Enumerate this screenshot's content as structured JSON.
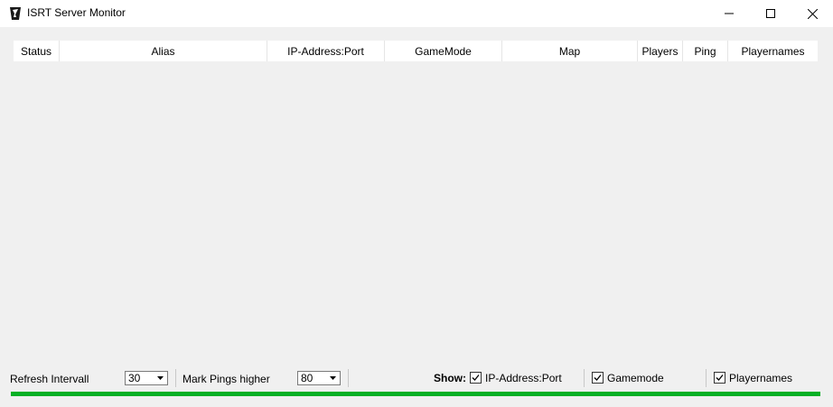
{
  "window": {
    "title": "ISRT Server Monitor",
    "minimize_label": "",
    "maximize_label": "",
    "close_label": ""
  },
  "table": {
    "columns": [
      "Status",
      "Alias",
      "IP-Address:Port",
      "GameMode",
      "Map",
      "Players",
      "Ping",
      "Playernames"
    ],
    "rows": []
  },
  "controls": {
    "refresh_label": "Refresh Intervall",
    "refresh_value": "30",
    "mark_pings_label": "Mark Pings higher",
    "mark_pings_value": "80",
    "show_label": "Show:",
    "show_ip_label": "IP-Address:Port",
    "show_ip_checked": true,
    "show_gamemode_label": "Gamemode",
    "show_gamemode_checked": true,
    "show_playernames_label": "Playernames",
    "show_playernames_checked": true
  },
  "progress": {
    "value": 1.0,
    "color": "#06b025"
  },
  "icons": {
    "app": "isrt-app-icon",
    "minimize": "minimize-icon",
    "maximize": "maximize-icon",
    "close": "close-icon",
    "dropdown": "dropdown-arrow-icon",
    "check": "checkmark-icon"
  }
}
